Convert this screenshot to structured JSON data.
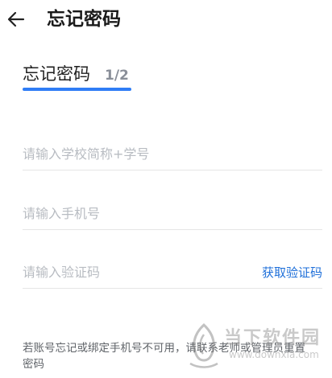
{
  "header": {
    "title": "忘记密码",
    "back_icon": "arrow-left-icon"
  },
  "step": {
    "title": "忘记密码",
    "indicator": "1/2"
  },
  "form": {
    "school_id_placeholder": "请输入学校简称+学号",
    "school_id_value": "",
    "phone_placeholder": "请输入手机号",
    "phone_value": "",
    "code_placeholder": "请输入验证码",
    "code_value": "",
    "get_code_label": "获取验证码"
  },
  "hint": {
    "text": "若账号忘记或绑定手机号不可用，请联系老师或管理员重置密码"
  },
  "watermark": {
    "text": "当下软件园",
    "url": "www.downxia.com"
  },
  "colors": {
    "accent": "#2f7df6",
    "link": "#1e6fd9"
  }
}
